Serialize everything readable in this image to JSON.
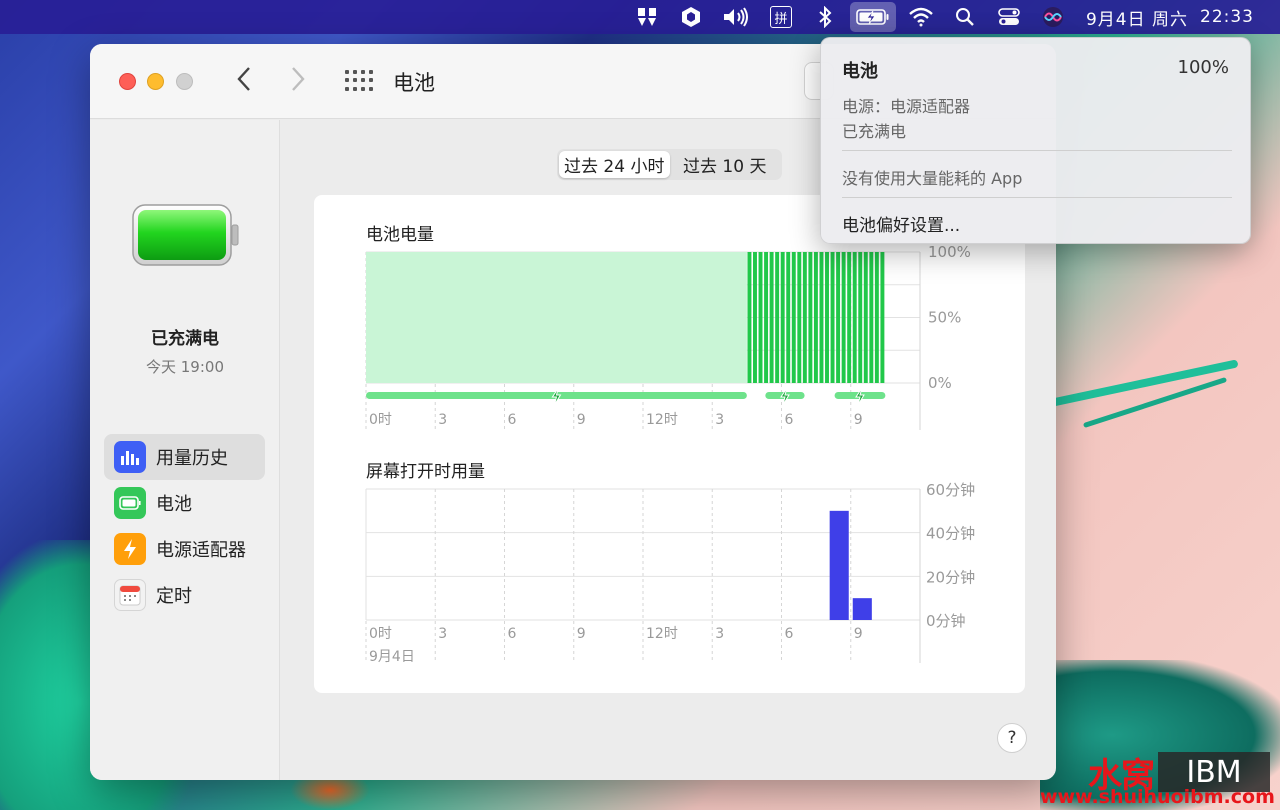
{
  "menubar": {
    "pin_label": "拼",
    "date": "9月4日 周六",
    "time": "22:33"
  },
  "window": {
    "title": "电池",
    "status_title": "已充满电",
    "status_time": "今天 19:00",
    "sidebar": [
      {
        "label": "用量历史",
        "icon": "chart-icon",
        "color": "#3e5ff5",
        "selected": true
      },
      {
        "label": "电池",
        "icon": "battery-icon",
        "color": "#34c759",
        "selected": false
      },
      {
        "label": "电源适配器",
        "icon": "bolt-icon",
        "color": "#ff9f0a",
        "selected": false
      },
      {
        "label": "定时",
        "icon": "calendar-icon",
        "color": "#e9e9e9",
        "selected": false
      }
    ],
    "segment": [
      "过去 24 小时",
      "过去 10 天"
    ],
    "help": "?"
  },
  "dropdown": {
    "title": "电池",
    "percent": "100%",
    "source": "电源：电源适配器",
    "state": "已充满电",
    "apps": "没有使用大量能耗的 App",
    "prefs": "电池偏好设置..."
  },
  "chart_data": [
    {
      "type": "area",
      "title": "电池电量",
      "x_ticks": [
        "0时",
        "3",
        "6",
        "9",
        "12时",
        "3",
        "6",
        "9"
      ],
      "y_ticks": [
        "100%",
        "50%",
        "0%"
      ],
      "ylim": [
        0,
        100
      ],
      "x_hours": [
        0,
        3,
        6,
        9,
        12,
        15,
        18,
        21
      ],
      "level_segment": {
        "from_hour": 0,
        "to_hour": 16.5,
        "level": 100
      },
      "bars": {
        "from_hour": 16.5,
        "to_hour": 22.5,
        "count": 25,
        "level": 100
      },
      "charging": [
        [
          0,
          16.5
        ],
        [
          17.3,
          19.0
        ],
        [
          20.3,
          22.5
        ]
      ],
      "colors": {
        "fill": "#c9f5d6",
        "bar": "#21c84a",
        "charge": "#6ee28b"
      }
    },
    {
      "type": "bar",
      "title": "屏幕打开时用量",
      "x_ticks": [
        "0时",
        "3",
        "6",
        "9",
        "12时",
        "3",
        "6",
        "9"
      ],
      "x_sublabel": "9月4日",
      "y_ticks": [
        "60分钟",
        "40分钟",
        "20分钟",
        "0分钟"
      ],
      "ylim": [
        0,
        60
      ],
      "bars": [
        {
          "hour": 20,
          "value": 50
        },
        {
          "hour": 21,
          "value": 10
        }
      ],
      "color": "#3f3fe8"
    }
  ],
  "watermark": {
    "brand": "水窝",
    "badge": "IBM",
    "url": "www.shuihuoibm.com"
  }
}
